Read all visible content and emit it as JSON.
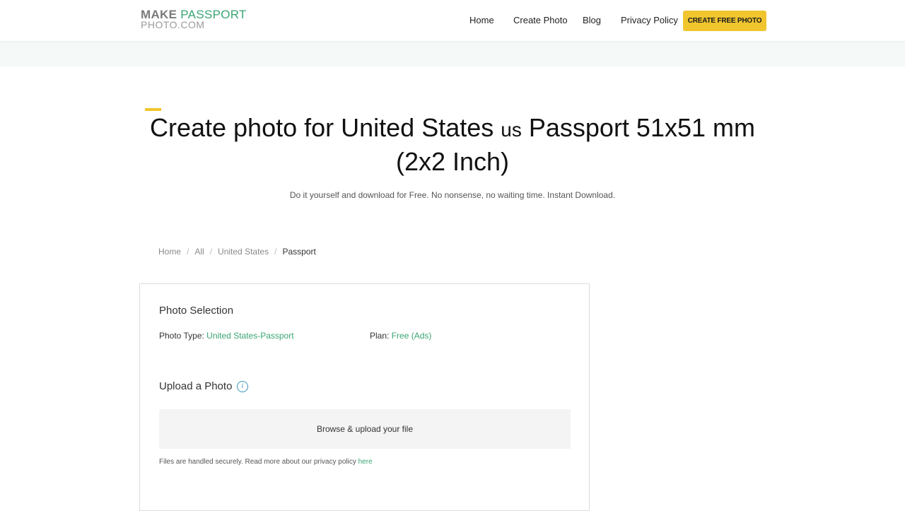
{
  "header": {
    "logo": {
      "line1_make": "MAKE",
      "line1_passport": "PASSPORT",
      "line2": "PHOTO.COM"
    },
    "nav": [
      {
        "label": "Home"
      },
      {
        "label": "Create Photo"
      },
      {
        "label": "Blog"
      },
      {
        "label": "Privacy Policy"
      }
    ],
    "cta_label": "CREATE FREE PHOTO"
  },
  "hero": {
    "title_part1": "Create photo for United States ",
    "country_code": "us",
    "title_part2": " Passport 51x51 mm (2x2 Inch)",
    "subtitle": "Do it yourself and download for Free. No nonsense, no waiting time. Instant Download."
  },
  "breadcrumb": {
    "items": [
      "Home",
      "All",
      "United States"
    ],
    "separator": "/",
    "current": "Passport"
  },
  "photo_selection": {
    "title": "Photo Selection",
    "photo_type_label": "Photo Type: ",
    "photo_type_value": "United States-Passport",
    "plan_label": "Plan: ",
    "plan_value": "Free (Ads)"
  },
  "upload": {
    "title": "Upload a Photo",
    "info_icon": "info-icon",
    "button_label": "Browse & upload your file",
    "note_text": "Files are handled securely. Read more about our privacy policy ",
    "note_link": "here"
  },
  "colors": {
    "accent_yellow": "#f0c52e",
    "brand_green": "#3aa574",
    "info_blue": "#3a96b8"
  }
}
